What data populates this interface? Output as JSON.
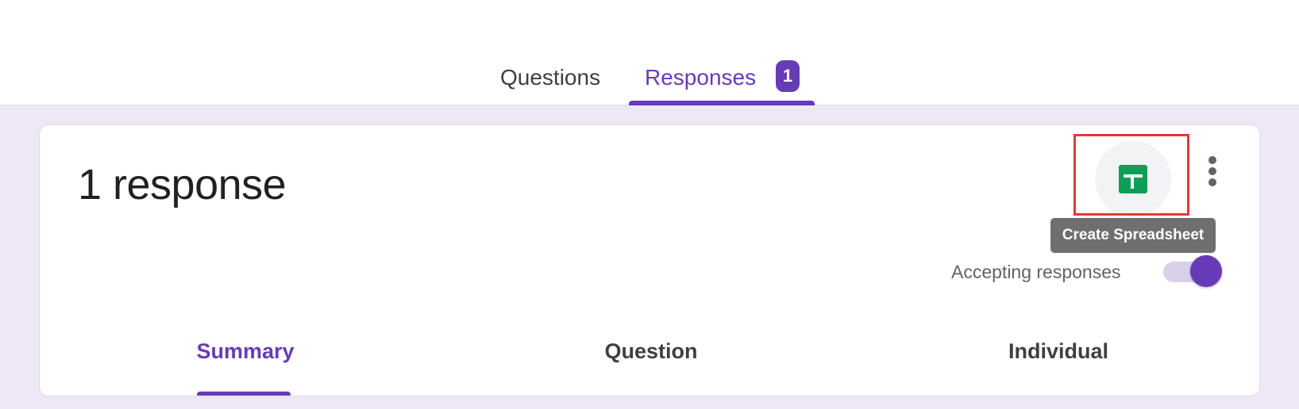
{
  "tabs": {
    "questions_label": "Questions",
    "responses_label": "Responses",
    "responses_count": "1"
  },
  "card": {
    "response_count": "1 response",
    "create_sheet_tooltip": "Create Spreadsheet",
    "accepting_label": "Accepting responses",
    "accepting_on": true
  },
  "subtabs": {
    "summary": "Summary",
    "question": "Question",
    "individual": "Individual"
  },
  "colors": {
    "accent": "#673ab7",
    "background": "#ede7f6",
    "sheets_green": "#0f9d58",
    "highlight": "#e53935"
  },
  "icons": {
    "create_sheet": "google-sheets-icon",
    "more": "more-vert-icon"
  }
}
